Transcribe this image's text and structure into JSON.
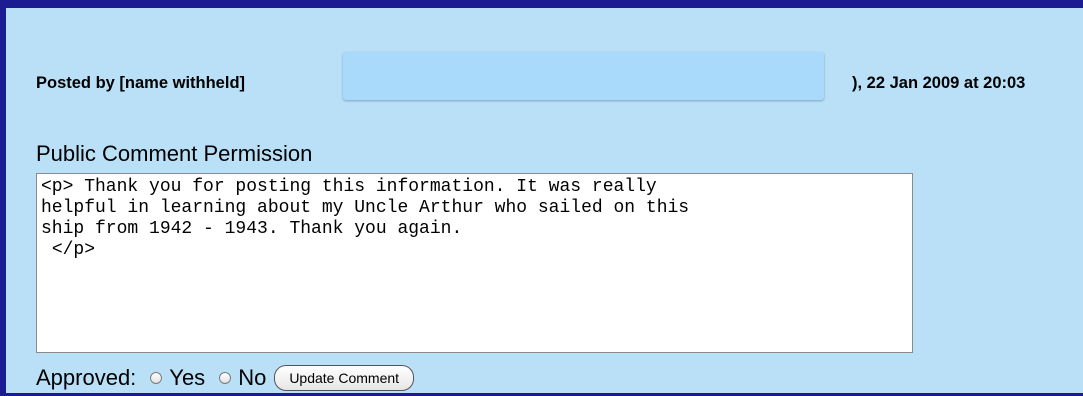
{
  "post": {
    "posted_by": "Posted by [name withheld]",
    "posted_date": "), 22 Jan 2009 at 20:03"
  },
  "comment": {
    "label": "Public Comment Permission",
    "text": "<p> Thank you for posting this information. It was really\nhelpful in learning about my Uncle Arthur who sailed on this\nship from 1942 - 1943. Thank you again.\n </p>"
  },
  "approval": {
    "label": "Approved:",
    "options": [
      "Yes",
      "No"
    ],
    "button_label": "Update Comment"
  },
  "colors": {
    "panel_bg": "#b9e0f6",
    "border": "#1c1c92",
    "redaction": "#a9d9fb"
  }
}
